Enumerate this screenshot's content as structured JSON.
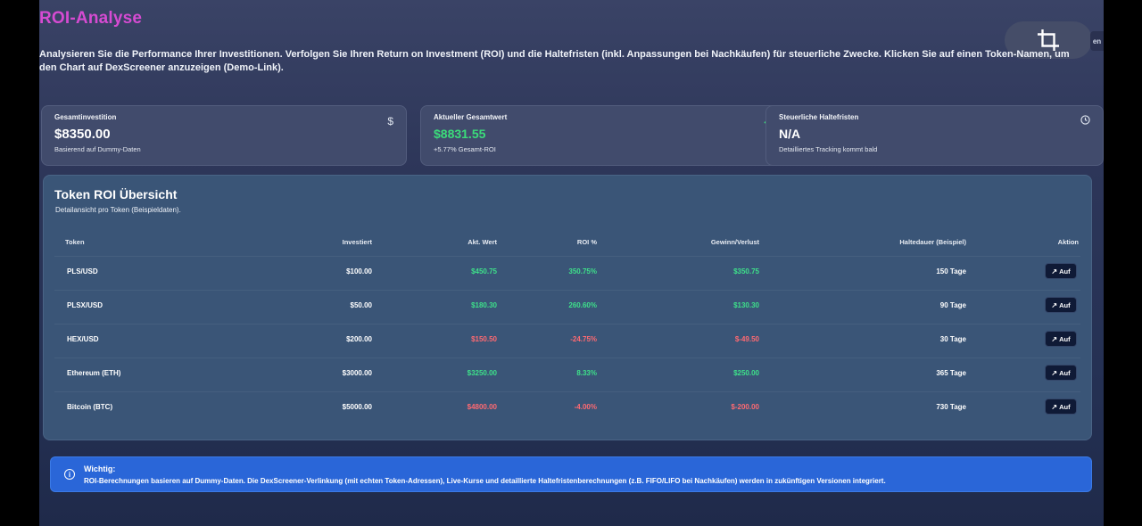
{
  "page": {
    "title": "ROI-Analyse",
    "intro": "Analysieren Sie die Performance Ihrer Investitionen. Verfolgen Sie Ihren Return on Investment (ROI) und die Haltefristen (inkl. Anpassungen bei Nachkäufen) für steuerliche Zwecke. Klicken Sie auf einen Token-Namen, um den Chart auf DexScreener anzuzeigen (Demo-Link).",
    "edge_chip": "en"
  },
  "cards": [
    {
      "title": "Gesamtinvestition",
      "value": "$8350.00",
      "sub": "Basierend auf Dummy-Daten",
      "icon": "dollar-icon"
    },
    {
      "title": "Aktueller Gesamtwert",
      "value": "$8831.55",
      "sub": "+5.77% Gesamt-ROI",
      "icon": "trending-up-icon"
    },
    {
      "title": "Steuerliche Haltefristen",
      "value": "N/A",
      "sub": "Detailliertes Tracking kommt bald",
      "icon": "clock-icon"
    }
  ],
  "overview": {
    "title": "Token ROI Übersicht",
    "subtitle": "Detailansicht pro Token (Beispieldaten).",
    "columns": [
      "Token",
      "Investiert",
      "Akt. Wert",
      "ROI %",
      "Gewinn/Verlust",
      "Haltedauer (Beispiel)",
      "Aktion"
    ],
    "rows": [
      {
        "token": "PLS/USD",
        "invested": "$100.00",
        "current": "$450.75",
        "roi": "350.75%",
        "pl": "$350.75",
        "hold": "150 Tage",
        "action": "Auf",
        "positive": true
      },
      {
        "token": "PLSX/USD",
        "invested": "$50.00",
        "current": "$180.30",
        "roi": "260.60%",
        "pl": "$130.30",
        "hold": "90 Tage",
        "action": "Auf",
        "positive": true
      },
      {
        "token": "HEX/USD",
        "invested": "$200.00",
        "current": "$150.50",
        "roi": "-24.75%",
        "pl": "$-49.50",
        "hold": "30 Tage",
        "action": "Auf",
        "positive": false
      },
      {
        "token": "Ethereum (ETH)",
        "invested": "$3000.00",
        "current": "$3250.00",
        "roi": "8.33%",
        "pl": "$250.00",
        "hold": "365 Tage",
        "action": "Auf",
        "positive": true
      },
      {
        "token": "Bitcoin (BTC)",
        "invested": "$5000.00",
        "current": "$4800.00",
        "roi": "-4.00%",
        "pl": "$-200.00",
        "hold": "730 Tage",
        "action": "Auf",
        "positive": false
      }
    ]
  },
  "notice": {
    "title": "Wichtig:",
    "text": "ROI-Berechnungen basieren auf Dummy-Daten. Die DexScreener-Verlinkung (mit echten Token-Adressen), Live-Kurse und detaillierte Haltefristenberechnungen (z.B. FIFO/LIFO bei Nachkäufen) werden in zukünftigen Versionen integriert.",
    "icon": "info-icon"
  },
  "colors": {
    "title_accent": "#d64bd2",
    "positive": "#3ee08a",
    "negative": "#ff6a72",
    "notice_bg": "#2a66d8",
    "button_bg": "#0f1a36"
  }
}
